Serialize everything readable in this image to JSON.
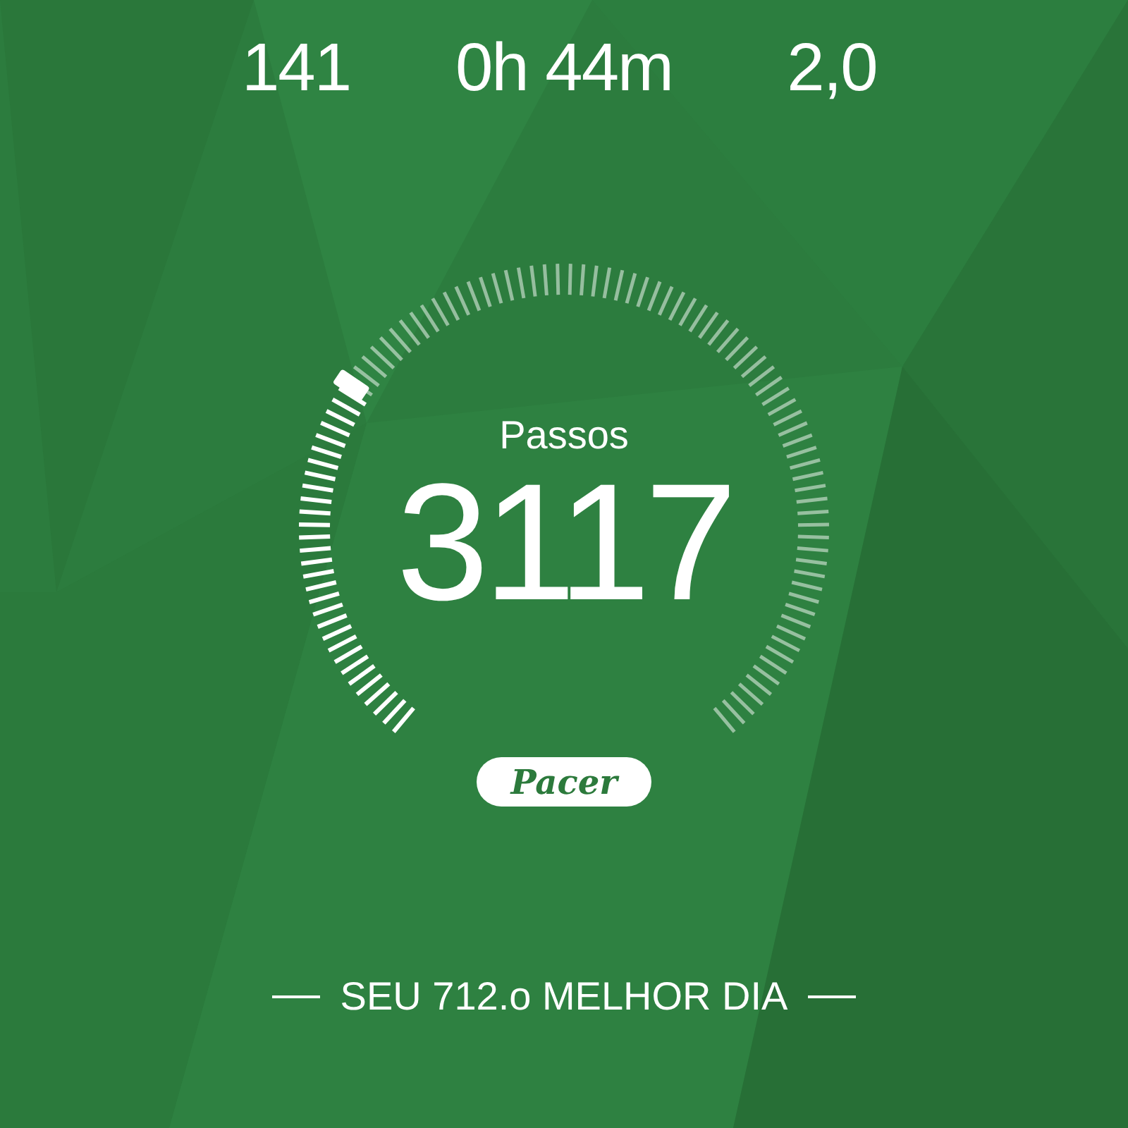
{
  "stats": [
    {
      "value": "141"
    },
    {
      "value": "0h 44m"
    },
    {
      "value": "2,0"
    }
  ],
  "steps": {
    "label": "Passos",
    "value": "3117"
  },
  "logo": "Pacer",
  "best_day": "SEU 712.o MELHOR DIA"
}
